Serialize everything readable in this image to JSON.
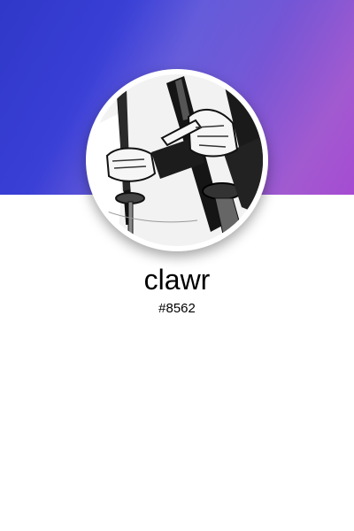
{
  "profile": {
    "username": "clawr",
    "tag": "#8562"
  },
  "colors": {
    "banner_start": "#2f38c8",
    "banner_end": "#a54bd2",
    "background": "#ffffff"
  }
}
